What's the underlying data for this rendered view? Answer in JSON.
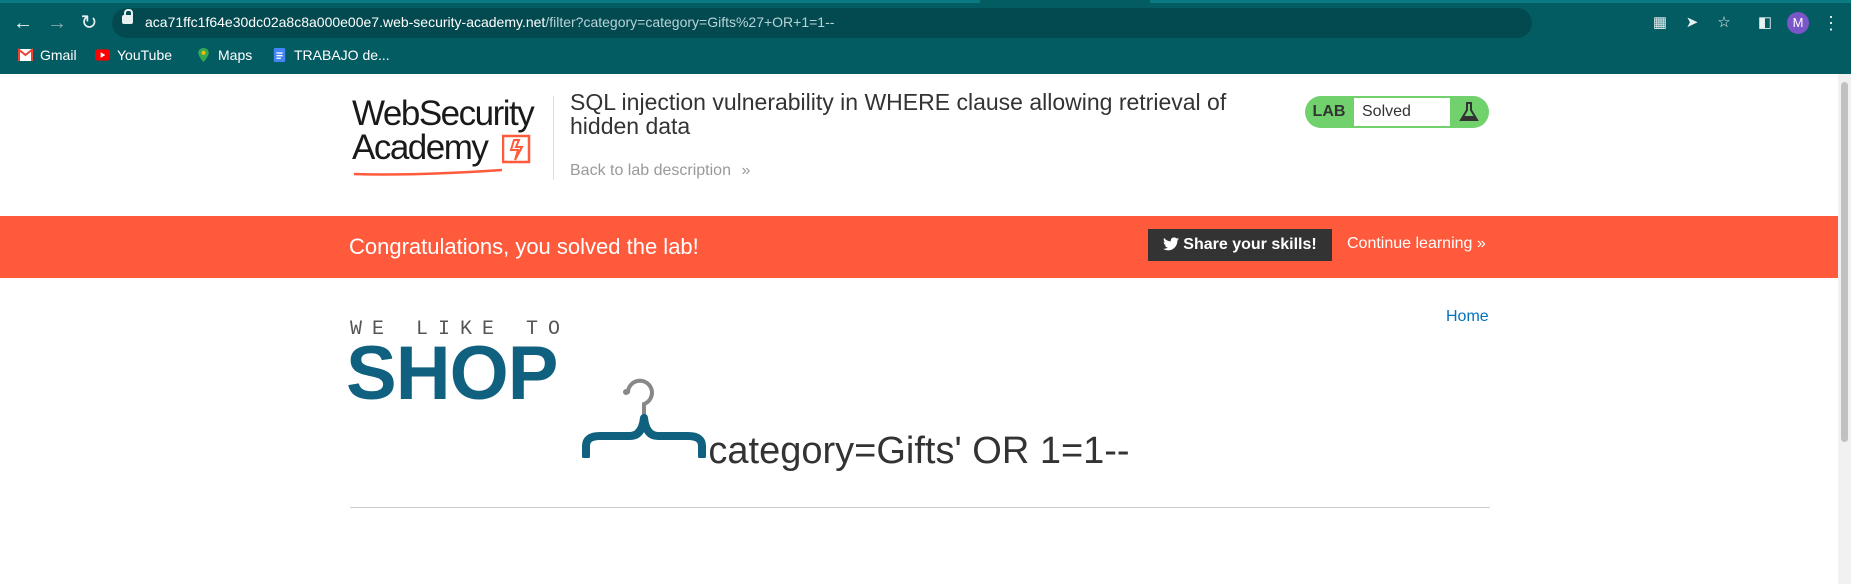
{
  "browser": {
    "url_host": "aca71ffc1f64e30dc02a8c8a000e00e7.web-security-academy.net",
    "url_path": "/filter?category=category=Gifts%27+OR+1=1--",
    "profile_initial": "M",
    "icons": [
      "back-icon",
      "forward-icon",
      "reload-icon",
      "lock-icon",
      "translate-icon",
      "send-icon",
      "star-icon",
      "sidepanel-icon",
      "menu-icon"
    ],
    "bookmarks": [
      {
        "label": "Gmail",
        "icon": "gmail-icon"
      },
      {
        "label": "YouTube",
        "icon": "youtube-icon"
      },
      {
        "label": "Maps",
        "icon": "maps-icon"
      },
      {
        "label": "TRABAJO de...",
        "icon": "docs-icon"
      }
    ]
  },
  "header": {
    "logo_line1": "WebSecurity",
    "logo_line2": "Academy",
    "lab_title": "SQL injection vulnerability in WHERE clause allowing retrieval of hidden data",
    "back_link": "Back to lab description",
    "lab_word": "LAB",
    "lab_status": "Solved",
    "colors": {
      "badge": "#70d16d",
      "banner": "#ff5a3c",
      "link": "#0071bc",
      "shop": "#10607f"
    }
  },
  "banner": {
    "message": "Congratulations, you solved the lab!",
    "share_label": "Share your skills!",
    "continue_label": "Continue learning"
  },
  "nav": {
    "home": "Home"
  },
  "shop": {
    "tagline": "WE LIKE TO",
    "word": "SHOP"
  },
  "main": {
    "heading": "category=Gifts' OR 1=1--"
  }
}
